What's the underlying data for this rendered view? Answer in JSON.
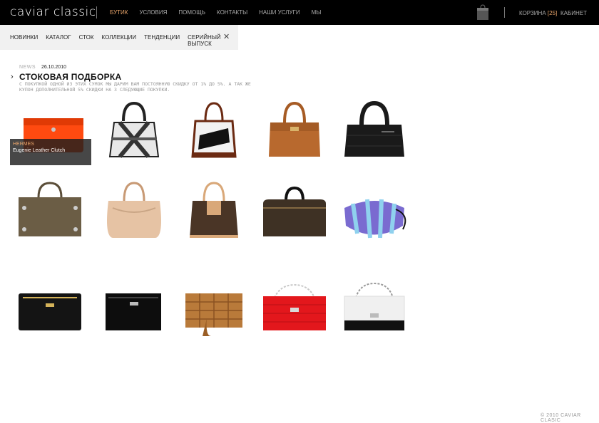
{
  "header": {
    "logo": "caviar classic",
    "nav": [
      "бутик",
      "условия",
      "помощь",
      "контакты",
      "наши услуги",
      "мы"
    ],
    "active_nav": "бутик",
    "cart_label": "корзина",
    "cart_count": "[25]",
    "cabinet_label": "кабинет",
    "bag_icon": "shopping-bag-icon"
  },
  "subnav": {
    "items": [
      "новинки",
      "каталог",
      "сток",
      "коллекции",
      "тенденции",
      "серийный выпуск"
    ],
    "close_icon": "close-icon"
  },
  "article": {
    "tag": "NEWS",
    "date": "26.10.2010",
    "title": "стоковая подборка",
    "description": "с покупкой одной из этих сумок мы дарим вам постоянную скидку от 1% до 5%. а так же купон дополнительной 5% скидки на 3 следующие покупки."
  },
  "tooltip": {
    "brand": "hermes",
    "name": "Eugenie Leather Clutch"
  },
  "products": [
    {
      "name": "orange-clutch",
      "color": "#ff4a10"
    },
    {
      "name": "plaid-tote",
      "color": "#2b2b2b"
    },
    {
      "name": "striped-tote",
      "color": "#6b2a12"
    },
    {
      "name": "tan-birkin",
      "color": "#b8692e"
    },
    {
      "name": "black-quilted-tote",
      "color": "#1a1a1a"
    },
    {
      "name": "olive-city-bag",
      "color": "#6b5d45"
    },
    {
      "name": "pink-hobo",
      "color": "#e6c3a4"
    },
    {
      "name": "monogram-tote",
      "color": "#4a3526"
    },
    {
      "name": "monogram-duffle",
      "color": "#3e3124"
    },
    {
      "name": "purple-pouch",
      "color": "#7a6bd0"
    },
    {
      "name": "black-zip-clutch",
      "color": "#141414"
    },
    {
      "name": "black-nylon-clutch",
      "color": "#0d0d0d"
    },
    {
      "name": "woven-clutch",
      "color": "#b97a3a"
    },
    {
      "name": "red-quilted-flap",
      "color": "#e3171c"
    },
    {
      "name": "white-black-flap",
      "color": "#f0f0f0"
    }
  ],
  "footer": "© 2010 caviar clasic"
}
